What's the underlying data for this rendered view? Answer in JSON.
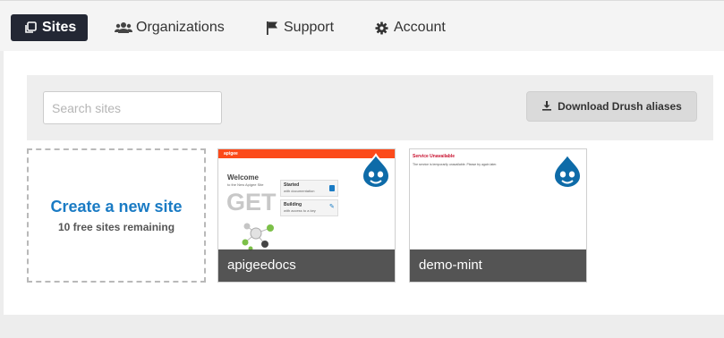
{
  "nav": {
    "tabs": [
      {
        "label": "Sites",
        "icon": "copy-icon",
        "active": true
      },
      {
        "label": "Organizations",
        "icon": "users-icon",
        "active": false
      },
      {
        "label": "Support",
        "icon": "flag-icon",
        "active": false
      },
      {
        "label": "Account",
        "icon": "gear-icon",
        "active": false
      }
    ]
  },
  "toolbar": {
    "search_placeholder": "Search sites",
    "search_value": "",
    "download_label": "Download Drush aliases"
  },
  "create_card": {
    "title": "Create a new site",
    "subtitle": "10 free sites remaining"
  },
  "sites": [
    {
      "name": "apigeedocs",
      "thumbnail": {
        "brand": "apigee",
        "heading": "Welcome",
        "subheading": "to the New Apigee Site",
        "big_text": "GET",
        "cards": [
          {
            "title": "Started",
            "subtitle": "with documentation"
          },
          {
            "title": "Building",
            "subtitle": "with access to a key"
          }
        ]
      }
    },
    {
      "name": "demo-mint",
      "thumbnail": {
        "heading": "Service Unavailable",
        "message": "The service is temporarily unavailable. Please try again later."
      }
    }
  ],
  "colors": {
    "active_tab_bg": "#232734",
    "accent_blue": "#1a7bc4",
    "drupal_blue": "#0e6ba8",
    "apigee_orange": "#fc4a1a",
    "error_red": "#c8102e"
  }
}
